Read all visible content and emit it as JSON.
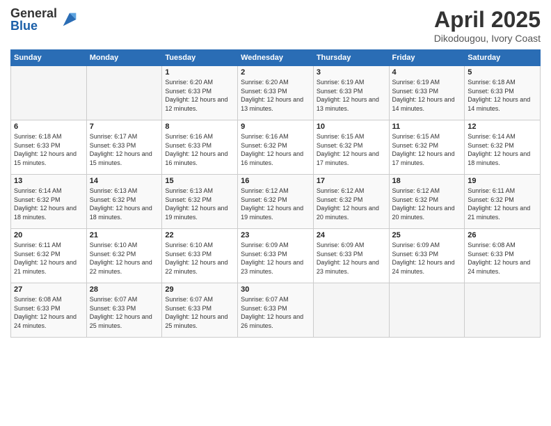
{
  "logo": {
    "general": "General",
    "blue": "Blue"
  },
  "title": "April 2025",
  "subtitle": "Dikodougou, Ivory Coast",
  "weekdays": [
    "Sunday",
    "Monday",
    "Tuesday",
    "Wednesday",
    "Thursday",
    "Friday",
    "Saturday"
  ],
  "weeks": [
    [
      {
        "day": "",
        "sunrise": "",
        "sunset": "",
        "daylight": ""
      },
      {
        "day": "",
        "sunrise": "",
        "sunset": "",
        "daylight": ""
      },
      {
        "day": "1",
        "sunrise": "Sunrise: 6:20 AM",
        "sunset": "Sunset: 6:33 PM",
        "daylight": "Daylight: 12 hours and 12 minutes."
      },
      {
        "day": "2",
        "sunrise": "Sunrise: 6:20 AM",
        "sunset": "Sunset: 6:33 PM",
        "daylight": "Daylight: 12 hours and 13 minutes."
      },
      {
        "day": "3",
        "sunrise": "Sunrise: 6:19 AM",
        "sunset": "Sunset: 6:33 PM",
        "daylight": "Daylight: 12 hours and 13 minutes."
      },
      {
        "day": "4",
        "sunrise": "Sunrise: 6:19 AM",
        "sunset": "Sunset: 6:33 PM",
        "daylight": "Daylight: 12 hours and 14 minutes."
      },
      {
        "day": "5",
        "sunrise": "Sunrise: 6:18 AM",
        "sunset": "Sunset: 6:33 PM",
        "daylight": "Daylight: 12 hours and 14 minutes."
      }
    ],
    [
      {
        "day": "6",
        "sunrise": "Sunrise: 6:18 AM",
        "sunset": "Sunset: 6:33 PM",
        "daylight": "Daylight: 12 hours and 15 minutes."
      },
      {
        "day": "7",
        "sunrise": "Sunrise: 6:17 AM",
        "sunset": "Sunset: 6:33 PM",
        "daylight": "Daylight: 12 hours and 15 minutes."
      },
      {
        "day": "8",
        "sunrise": "Sunrise: 6:16 AM",
        "sunset": "Sunset: 6:33 PM",
        "daylight": "Daylight: 12 hours and 16 minutes."
      },
      {
        "day": "9",
        "sunrise": "Sunrise: 6:16 AM",
        "sunset": "Sunset: 6:32 PM",
        "daylight": "Daylight: 12 hours and 16 minutes."
      },
      {
        "day": "10",
        "sunrise": "Sunrise: 6:15 AM",
        "sunset": "Sunset: 6:32 PM",
        "daylight": "Daylight: 12 hours and 17 minutes."
      },
      {
        "day": "11",
        "sunrise": "Sunrise: 6:15 AM",
        "sunset": "Sunset: 6:32 PM",
        "daylight": "Daylight: 12 hours and 17 minutes."
      },
      {
        "day": "12",
        "sunrise": "Sunrise: 6:14 AM",
        "sunset": "Sunset: 6:32 PM",
        "daylight": "Daylight: 12 hours and 18 minutes."
      }
    ],
    [
      {
        "day": "13",
        "sunrise": "Sunrise: 6:14 AM",
        "sunset": "Sunset: 6:32 PM",
        "daylight": "Daylight: 12 hours and 18 minutes."
      },
      {
        "day": "14",
        "sunrise": "Sunrise: 6:13 AM",
        "sunset": "Sunset: 6:32 PM",
        "daylight": "Daylight: 12 hours and 18 minutes."
      },
      {
        "day": "15",
        "sunrise": "Sunrise: 6:13 AM",
        "sunset": "Sunset: 6:32 PM",
        "daylight": "Daylight: 12 hours and 19 minutes."
      },
      {
        "day": "16",
        "sunrise": "Sunrise: 6:12 AM",
        "sunset": "Sunset: 6:32 PM",
        "daylight": "Daylight: 12 hours and 19 minutes."
      },
      {
        "day": "17",
        "sunrise": "Sunrise: 6:12 AM",
        "sunset": "Sunset: 6:32 PM",
        "daylight": "Daylight: 12 hours and 20 minutes."
      },
      {
        "day": "18",
        "sunrise": "Sunrise: 6:12 AM",
        "sunset": "Sunset: 6:32 PM",
        "daylight": "Daylight: 12 hours and 20 minutes."
      },
      {
        "day": "19",
        "sunrise": "Sunrise: 6:11 AM",
        "sunset": "Sunset: 6:32 PM",
        "daylight": "Daylight: 12 hours and 21 minutes."
      }
    ],
    [
      {
        "day": "20",
        "sunrise": "Sunrise: 6:11 AM",
        "sunset": "Sunset: 6:32 PM",
        "daylight": "Daylight: 12 hours and 21 minutes."
      },
      {
        "day": "21",
        "sunrise": "Sunrise: 6:10 AM",
        "sunset": "Sunset: 6:32 PM",
        "daylight": "Daylight: 12 hours and 22 minutes."
      },
      {
        "day": "22",
        "sunrise": "Sunrise: 6:10 AM",
        "sunset": "Sunset: 6:33 PM",
        "daylight": "Daylight: 12 hours and 22 minutes."
      },
      {
        "day": "23",
        "sunrise": "Sunrise: 6:09 AM",
        "sunset": "Sunset: 6:33 PM",
        "daylight": "Daylight: 12 hours and 23 minutes."
      },
      {
        "day": "24",
        "sunrise": "Sunrise: 6:09 AM",
        "sunset": "Sunset: 6:33 PM",
        "daylight": "Daylight: 12 hours and 23 minutes."
      },
      {
        "day": "25",
        "sunrise": "Sunrise: 6:09 AM",
        "sunset": "Sunset: 6:33 PM",
        "daylight": "Daylight: 12 hours and 24 minutes."
      },
      {
        "day": "26",
        "sunrise": "Sunrise: 6:08 AM",
        "sunset": "Sunset: 6:33 PM",
        "daylight": "Daylight: 12 hours and 24 minutes."
      }
    ],
    [
      {
        "day": "27",
        "sunrise": "Sunrise: 6:08 AM",
        "sunset": "Sunset: 6:33 PM",
        "daylight": "Daylight: 12 hours and 24 minutes."
      },
      {
        "day": "28",
        "sunrise": "Sunrise: 6:07 AM",
        "sunset": "Sunset: 6:33 PM",
        "daylight": "Daylight: 12 hours and 25 minutes."
      },
      {
        "day": "29",
        "sunrise": "Sunrise: 6:07 AM",
        "sunset": "Sunset: 6:33 PM",
        "daylight": "Daylight: 12 hours and 25 minutes."
      },
      {
        "day": "30",
        "sunrise": "Sunrise: 6:07 AM",
        "sunset": "Sunset: 6:33 PM",
        "daylight": "Daylight: 12 hours and 26 minutes."
      },
      {
        "day": "",
        "sunrise": "",
        "sunset": "",
        "daylight": ""
      },
      {
        "day": "",
        "sunrise": "",
        "sunset": "",
        "daylight": ""
      },
      {
        "day": "",
        "sunrise": "",
        "sunset": "",
        "daylight": ""
      }
    ]
  ]
}
